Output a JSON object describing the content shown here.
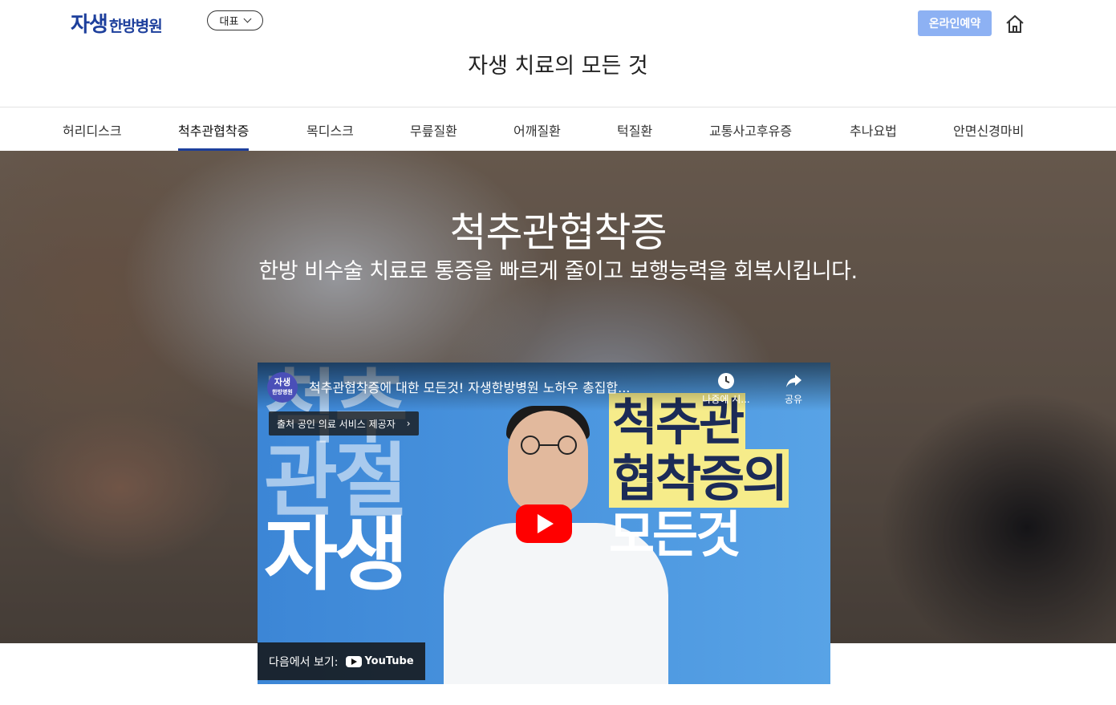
{
  "header": {
    "logo_big": "자생",
    "logo_small": "한방병원",
    "branch_select": "대표",
    "reserve_label": "온라인예약",
    "page_title": "자생 치료의 모든 것"
  },
  "tabs": [
    {
      "label": "허리디스크",
      "active": false
    },
    {
      "label": "척추관협착증",
      "active": true
    },
    {
      "label": "목디스크",
      "active": false
    },
    {
      "label": "무릎질환",
      "active": false
    },
    {
      "label": "어깨질환",
      "active": false
    },
    {
      "label": "턱질환",
      "active": false
    },
    {
      "label": "교통사고후유증",
      "active": false
    },
    {
      "label": "추나요법",
      "active": false
    },
    {
      "label": "안면신경마비",
      "active": false
    }
  ],
  "hero": {
    "title": "척추관협착증",
    "subtitle": "한방 비수술 치료로 통증을 빠르게 줄이고 보행능력을 회복시킵니다."
  },
  "video": {
    "channel_avatar_top": "자생",
    "channel_avatar_bottom": "한방병원",
    "title": "척추관협착증에 대한 모든것! 자생한방병원 노하우 총집합...",
    "watch_later": "나중에 시...",
    "share": "공유",
    "info_badge": "출처 공인 의료 서비스 제공자",
    "watch_on": "다음에서 보기:",
    "youtube": "YouTube",
    "thumb_left": [
      "척추",
      "관절",
      "자생"
    ],
    "thumb_right": [
      "척추관",
      "협착증의",
      "모든것"
    ]
  },
  "colors": {
    "brand": "#1d3f9c",
    "reserve_bg": "#8db1f3",
    "youtube_red": "#ff0000"
  }
}
